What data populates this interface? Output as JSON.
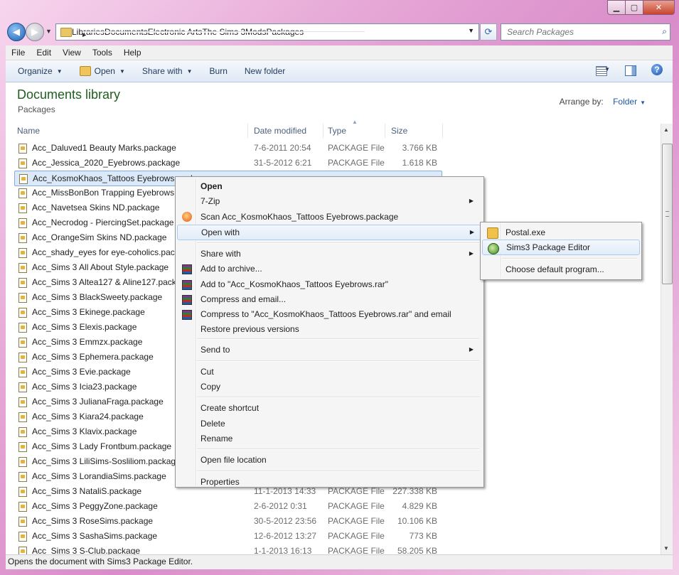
{
  "window": {
    "caption_buttons": [
      "minimize",
      "maximize",
      "close"
    ]
  },
  "nav": {
    "breadcrumbs": [
      "Libraries",
      "Documents",
      "Electronic Arts",
      "The Sims 3",
      "Mods",
      "Packages"
    ],
    "search_placeholder": "Search Packages"
  },
  "menubar": [
    "File",
    "Edit",
    "View",
    "Tools",
    "Help"
  ],
  "toolbar": {
    "organize": "Organize",
    "open": "Open",
    "share_with": "Share with",
    "burn": "Burn",
    "new_folder": "New folder"
  },
  "library": {
    "title": "Documents library",
    "subtitle": "Packages",
    "arrange_label": "Arrange by:",
    "arrange_value": "Folder"
  },
  "columns": [
    "Name",
    "Date modified",
    "Type",
    "Size"
  ],
  "files": [
    {
      "name": "Acc_Daluved1 Beauty Marks.package",
      "date": "7-6-2011 20:54",
      "type": "PACKAGE File",
      "size": "3.766 KB"
    },
    {
      "name": "Acc_Jessica_2020_Eyebrows.package",
      "date": "31-5-2012 6:21",
      "type": "PACKAGE File",
      "size": "1.618 KB"
    },
    {
      "name": "Acc_KosmoKhaos_Tattoos Eyebrows.package",
      "date": "",
      "type": "",
      "size": "",
      "selected": true
    },
    {
      "name": "Acc_MissBonBon Trapping Eyebrows.package",
      "date": "",
      "type": "",
      "size": ""
    },
    {
      "name": "Acc_Navetsea Skins ND.package",
      "date": "",
      "type": "",
      "size": ""
    },
    {
      "name": "Acc_Necrodog - PiercingSet.package",
      "date": "",
      "type": "",
      "size": ""
    },
    {
      "name": "Acc_OrangeSim Skins ND.package",
      "date": "",
      "type": "",
      "size": ""
    },
    {
      "name": "Acc_shady_eyes for eye-coholics.package",
      "date": "",
      "type": "",
      "size": ""
    },
    {
      "name": "Acc_Sims 3 All About Style.package",
      "date": "",
      "type": "",
      "size": ""
    },
    {
      "name": "Acc_Sims 3 Altea127 & Aline127.package",
      "date": "",
      "type": "",
      "size": ""
    },
    {
      "name": "Acc_Sims 3 BlackSweety.package",
      "date": "",
      "type": "",
      "size": ""
    },
    {
      "name": "Acc_Sims 3 Ekinege.package",
      "date": "",
      "type": "",
      "size": ""
    },
    {
      "name": "Acc_Sims 3 Elexis.package",
      "date": "",
      "type": "",
      "size": ""
    },
    {
      "name": "Acc_Sims 3 Emmzx.package",
      "date": "",
      "type": "",
      "size": ""
    },
    {
      "name": "Acc_Sims 3 Ephemera.package",
      "date": "",
      "type": "",
      "size": ""
    },
    {
      "name": "Acc_Sims 3 Evie.package",
      "date": "",
      "type": "",
      "size": ""
    },
    {
      "name": "Acc_Sims 3 Icia23.package",
      "date": "",
      "type": "",
      "size": ""
    },
    {
      "name": "Acc_Sims 3 JulianaFraga.package",
      "date": "",
      "type": "",
      "size": ""
    },
    {
      "name": "Acc_Sims 3 Kiara24.package",
      "date": "",
      "type": "",
      "size": ""
    },
    {
      "name": "Acc_Sims 3 Klavix.package",
      "date": "",
      "type": "",
      "size": ""
    },
    {
      "name": "Acc_Sims 3 Lady Frontbum.package",
      "date": "",
      "type": "",
      "size": ""
    },
    {
      "name": "Acc_Sims 3 LiliSims-Sosliliom.package",
      "date": "",
      "type": "",
      "size": ""
    },
    {
      "name": "Acc_Sims 3 LorandiaSims.package",
      "date": "",
      "type": "",
      "size": ""
    },
    {
      "name": "Acc_Sims 3 NataliS.package",
      "date": "11-1-2013 14:33",
      "type": "PACKAGE File",
      "size": "227.338 KB"
    },
    {
      "name": "Acc_Sims 3 PeggyZone.package",
      "date": "2-6-2012 0:31",
      "type": "PACKAGE File",
      "size": "4.829 KB"
    },
    {
      "name": "Acc_Sims 3 RoseSims.package",
      "date": "30-5-2012 23:56",
      "type": "PACKAGE File",
      "size": "10.106 KB"
    },
    {
      "name": "Acc_Sims 3 SashaSims.package",
      "date": "12-6-2012 13:27",
      "type": "PACKAGE File",
      "size": "773 KB"
    },
    {
      "name": "Acc_Sims 3 S-Club.package",
      "date": "1-1-2013 16:13",
      "type": "PACKAGE File",
      "size": "58.205 KB"
    }
  ],
  "context_menu": [
    {
      "label": "Open",
      "bold": true
    },
    {
      "label": "7-Zip",
      "submenu": true
    },
    {
      "label": "Scan Acc_KosmoKhaos_Tattoos Eyebrows.package",
      "icon": "antivirus-icon"
    },
    {
      "label": "Open with",
      "submenu": true,
      "highlight": true
    },
    {
      "sep": true
    },
    {
      "label": "Share with",
      "submenu": true
    },
    {
      "label": "Add to archive...",
      "icon": "winrar-icon"
    },
    {
      "label": "Add to \"Acc_KosmoKhaos_Tattoos Eyebrows.rar\"",
      "icon": "winrar-icon"
    },
    {
      "label": "Compress and email...",
      "icon": "winrar-icon"
    },
    {
      "label": "Compress to \"Acc_KosmoKhaos_Tattoos Eyebrows.rar\" and email",
      "icon": "winrar-icon"
    },
    {
      "label": "Restore previous versions"
    },
    {
      "sep": true
    },
    {
      "label": "Send to",
      "submenu": true
    },
    {
      "sep": true
    },
    {
      "label": "Cut"
    },
    {
      "label": "Copy"
    },
    {
      "sep": true
    },
    {
      "label": "Create shortcut"
    },
    {
      "label": "Delete"
    },
    {
      "label": "Rename"
    },
    {
      "sep": true
    },
    {
      "label": "Open file location"
    },
    {
      "sep": true
    },
    {
      "label": "Properties"
    }
  ],
  "open_with": [
    {
      "label": "Postal.exe",
      "icon": "postal-icon"
    },
    {
      "label": "Sims3 Package Editor",
      "icon": "sims3-icon",
      "highlight": true
    },
    {
      "sep": true
    },
    {
      "label": "Choose default program..."
    }
  ],
  "status": "Opens the document with Sims3 Package Editor."
}
